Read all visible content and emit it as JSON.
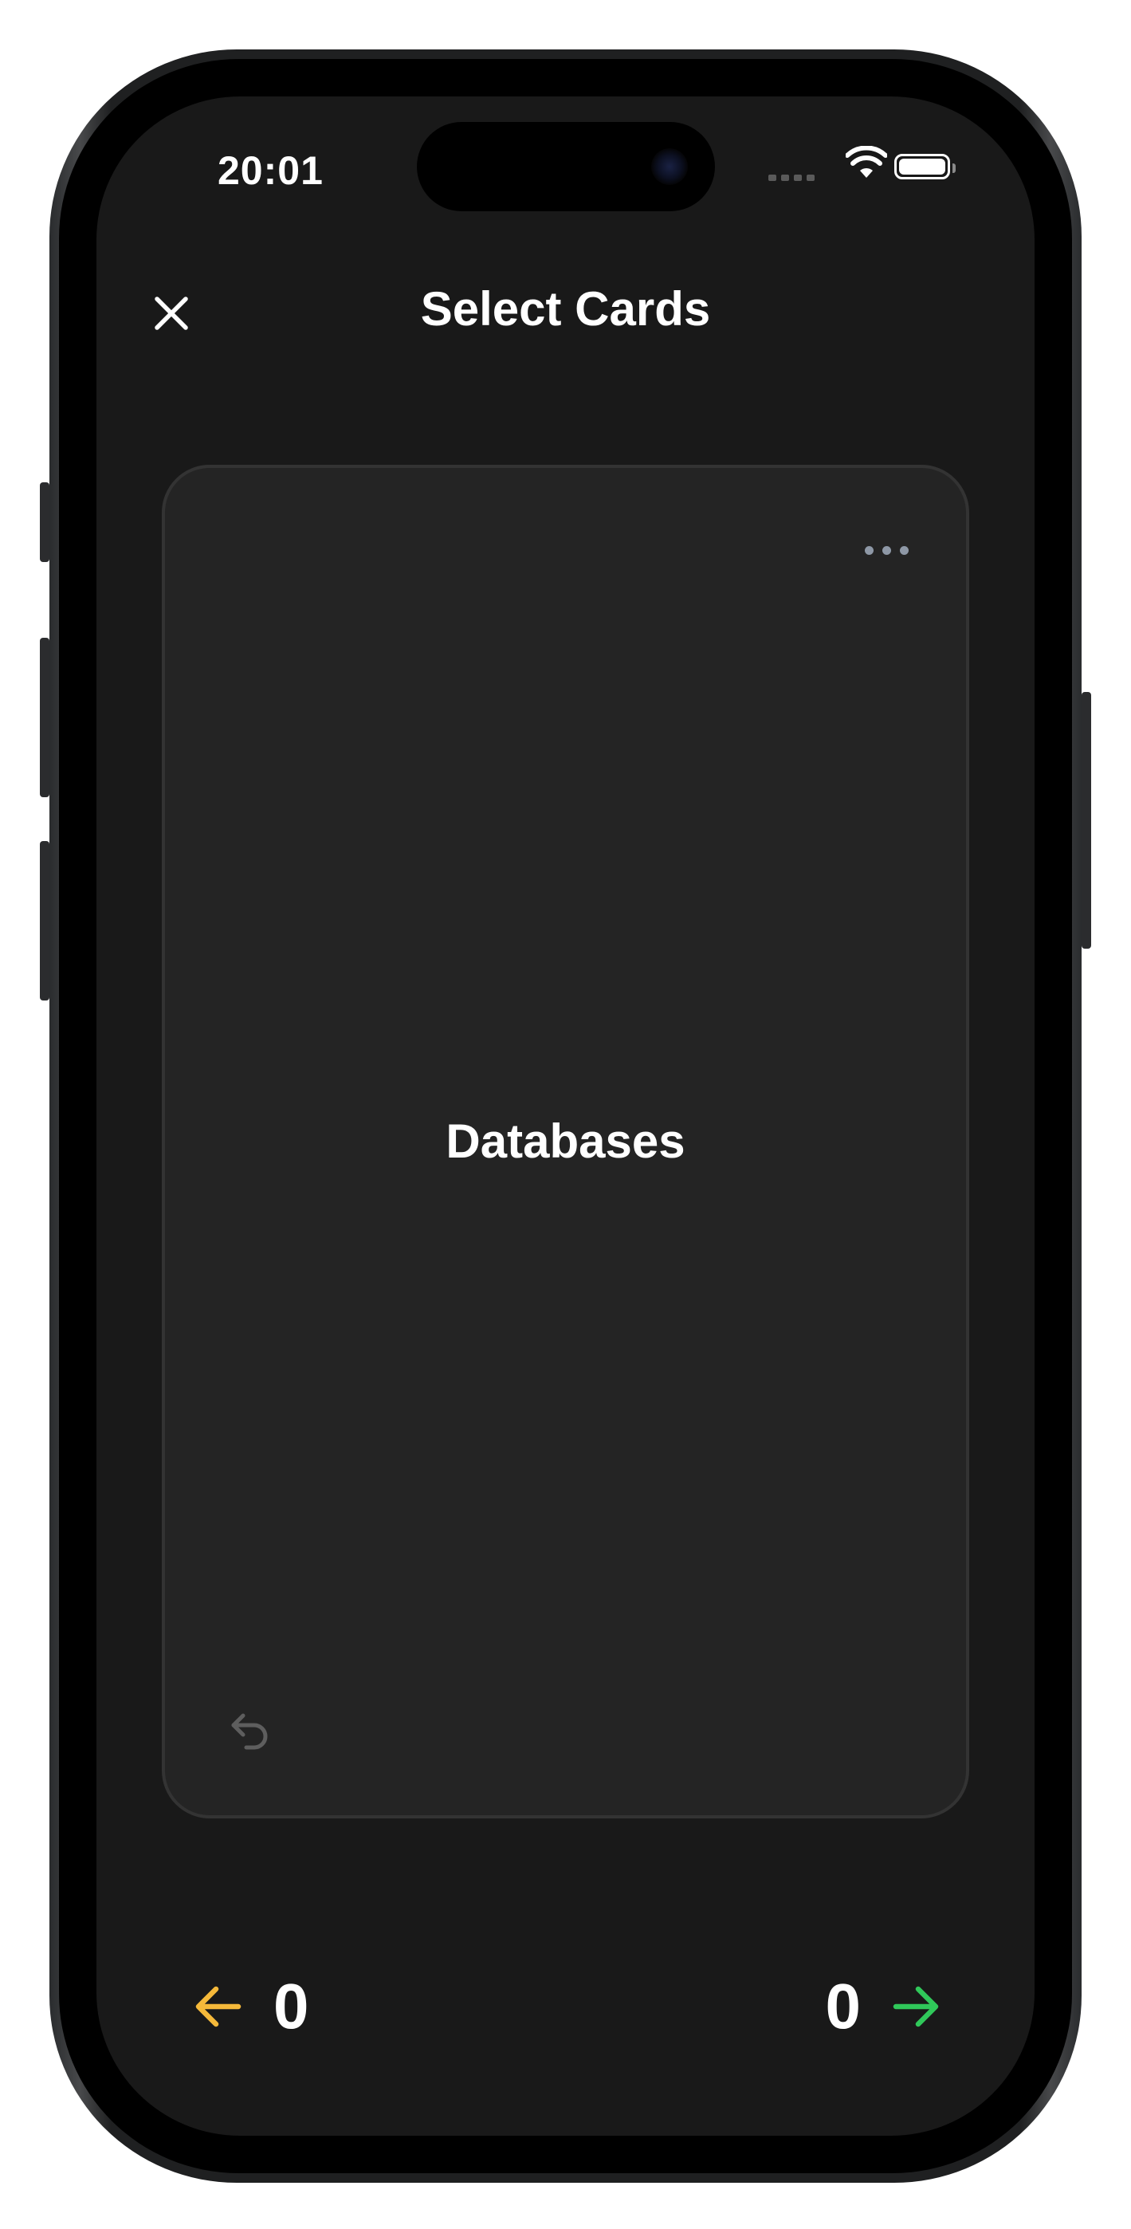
{
  "status_bar": {
    "time": "20:01"
  },
  "header": {
    "title": "Select Cards",
    "close_icon": "close-icon"
  },
  "card": {
    "term": "Databases",
    "menu_icon": "ellipsis-icon",
    "undo_icon": "undo-icon"
  },
  "counters": {
    "left": {
      "value": "0",
      "icon": "arrow-left-icon",
      "color": "#F5B93A"
    },
    "right": {
      "value": "0",
      "icon": "arrow-right-icon",
      "color": "#30C85A"
    }
  },
  "colors": {
    "screen_background": "#191919",
    "card_background": "#242424"
  }
}
